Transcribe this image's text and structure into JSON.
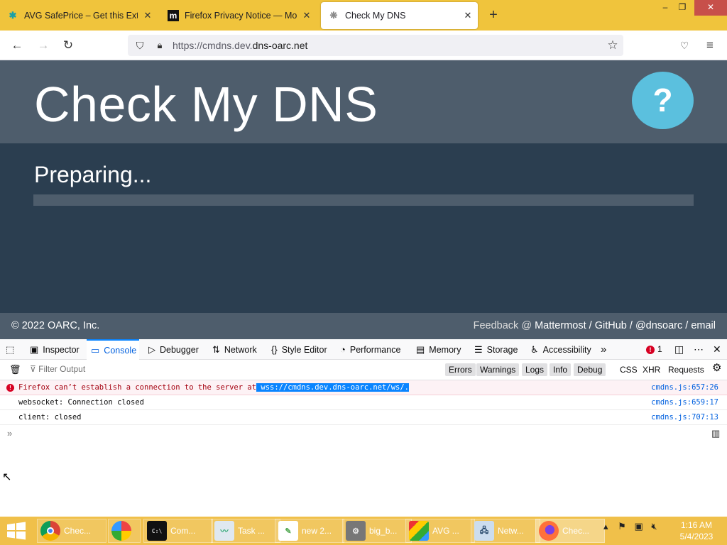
{
  "browser": {
    "tabs": [
      {
        "title": "AVG SafePrice – Get this Extensi",
        "icon": "avg-icon",
        "active": false
      },
      {
        "title": "Firefox Privacy Notice — Mozilla",
        "icon": "mozilla-icon",
        "active": false
      },
      {
        "title": "Check My DNS",
        "icon": "page-icon",
        "active": true
      }
    ],
    "new_tab": "+",
    "window_controls": {
      "minimize": "–",
      "maximize": "❐",
      "close": "✕"
    },
    "url_prefix": "https://cmdns.dev.",
    "url_domain": "dns-oarc.net"
  },
  "page": {
    "title": "Check My DNS",
    "help": "?",
    "status": "Preparing...",
    "progress": 0,
    "copyright_prefix": "© 2022",
    "copyright_org": "OARC, Inc.",
    "feedback_label": "Feedback @",
    "feedback_links": [
      "Mattermost",
      "GitHub",
      "@dnsoarc",
      "email"
    ],
    "separator": "/"
  },
  "devtools": {
    "tabs": [
      {
        "label": "Inspector",
        "icon": "inspector-icon"
      },
      {
        "label": "Console",
        "icon": "console-icon",
        "active": true
      },
      {
        "label": "Debugger",
        "icon": "debugger-icon"
      },
      {
        "label": "Network",
        "icon": "network-icon"
      },
      {
        "label": "Style Editor",
        "icon": "style-editor-icon"
      },
      {
        "label": "Performance",
        "icon": "performance-icon"
      },
      {
        "label": "Memory",
        "icon": "memory-icon"
      },
      {
        "label": "Storage",
        "icon": "storage-icon"
      },
      {
        "label": "Accessibility",
        "icon": "accessibility-icon"
      }
    ],
    "error_count": "1",
    "filter_placeholder": "Filter Output",
    "filters": [
      "Errors",
      "Warnings",
      "Logs",
      "Info",
      "Debug"
    ],
    "net_filters": [
      "CSS",
      "XHR",
      "Requests"
    ],
    "messages": [
      {
        "text": "Firefox can’t establish a connection to the server at",
        "highlight": " wss://cmdns.dev.dns-oarc.net/ws/.",
        "location": "cmdns.js:657:26",
        "level": "error"
      },
      {
        "text": "websocket: Connection closed",
        "location": "cmdns.js:659:17",
        "level": "log"
      },
      {
        "text": "client: closed",
        "location": "cmdns.js:707:13",
        "level": "log"
      }
    ]
  },
  "taskbar": {
    "items": [
      {
        "label": "Chec...",
        "icon": "chrome-icon"
      },
      {
        "label": "",
        "icon": "avg-browser-icon"
      },
      {
        "label": "Com...",
        "icon": "command-prompt-icon"
      },
      {
        "label": "Task ...",
        "icon": "task-manager-icon"
      },
      {
        "label": "new 2...",
        "icon": "notepad-plus-icon"
      },
      {
        "label": "big_b...",
        "icon": "media-icon"
      },
      {
        "label": "AVG ...",
        "icon": "avg-icon"
      },
      {
        "label": "Netw...",
        "icon": "network-icon"
      },
      {
        "label": "Chec...",
        "icon": "firefox-icon",
        "active": true
      }
    ],
    "time": "1:16 AM",
    "date": "5/4/2023"
  },
  "colors": {
    "tabbar": "#f0c43c",
    "header": "#4e5d6c",
    "main": "#2b3e50",
    "help_button": "#5bc0de",
    "error": "#d70022",
    "selection": "#0a84ff"
  }
}
